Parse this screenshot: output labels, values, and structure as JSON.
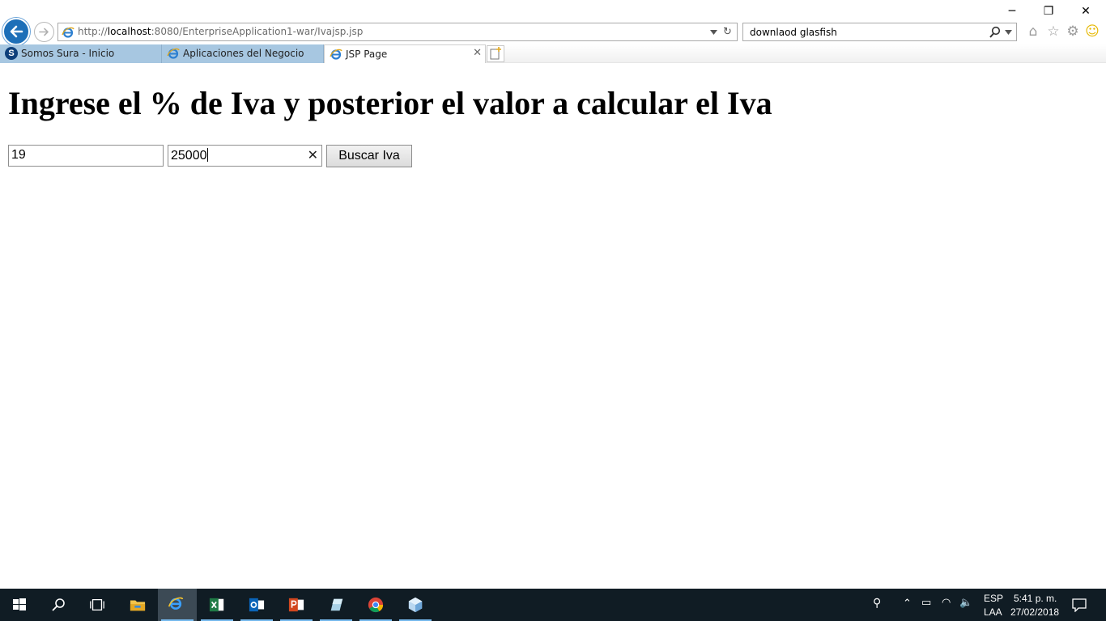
{
  "browser": {
    "url_prefix": "http://",
    "url_host": "localhost",
    "url_rest": ":8080/EnterpriseApplication1-war/Ivajsp.jsp",
    "search_value": "downlaod glasfish",
    "icons": [
      "back-icon",
      "forward-icon",
      "ie-icon",
      "refresh-icon",
      "search-icon",
      "home-icon",
      "favorites-star-icon",
      "settings-gear-icon",
      "smiley-feedback-icon"
    ]
  },
  "window": {
    "minimize": "─",
    "restore": "❐",
    "close": "✕"
  },
  "tabs": [
    {
      "label": "Somos Sura - Inicio",
      "icon": "sura-icon",
      "active": false
    },
    {
      "label": "Aplicaciones del Negocio",
      "icon": "ie-icon",
      "active": false
    },
    {
      "label": "JSP Page",
      "icon": "ie-icon",
      "active": true,
      "close": "✕"
    }
  ],
  "page": {
    "heading": "Ingrese el % de Iva y posterior el valor a calcular el Iva",
    "iva_percent_value": "19",
    "amount_value": "25000",
    "clear_glyph": "✕",
    "button_label": "Buscar Iva"
  },
  "taskbar": {
    "apps": [
      "windows-start-icon",
      "search-icon",
      "task-view-icon",
      "file-explorer-icon",
      "internet-explorer-icon",
      "excel-icon",
      "outlook-icon",
      "powerpoint-icon",
      "app-icon",
      "chrome-icon",
      "virtualbox-icon"
    ],
    "lang_top": "ESP",
    "lang_bottom": "LAA",
    "time": "5:41 p. m.",
    "date": "27/02/2018"
  },
  "colors": {
    "accent_blue": "#1d6fb8",
    "tab_inactive": "#a7c7e1",
    "taskbar": "#101c24"
  }
}
